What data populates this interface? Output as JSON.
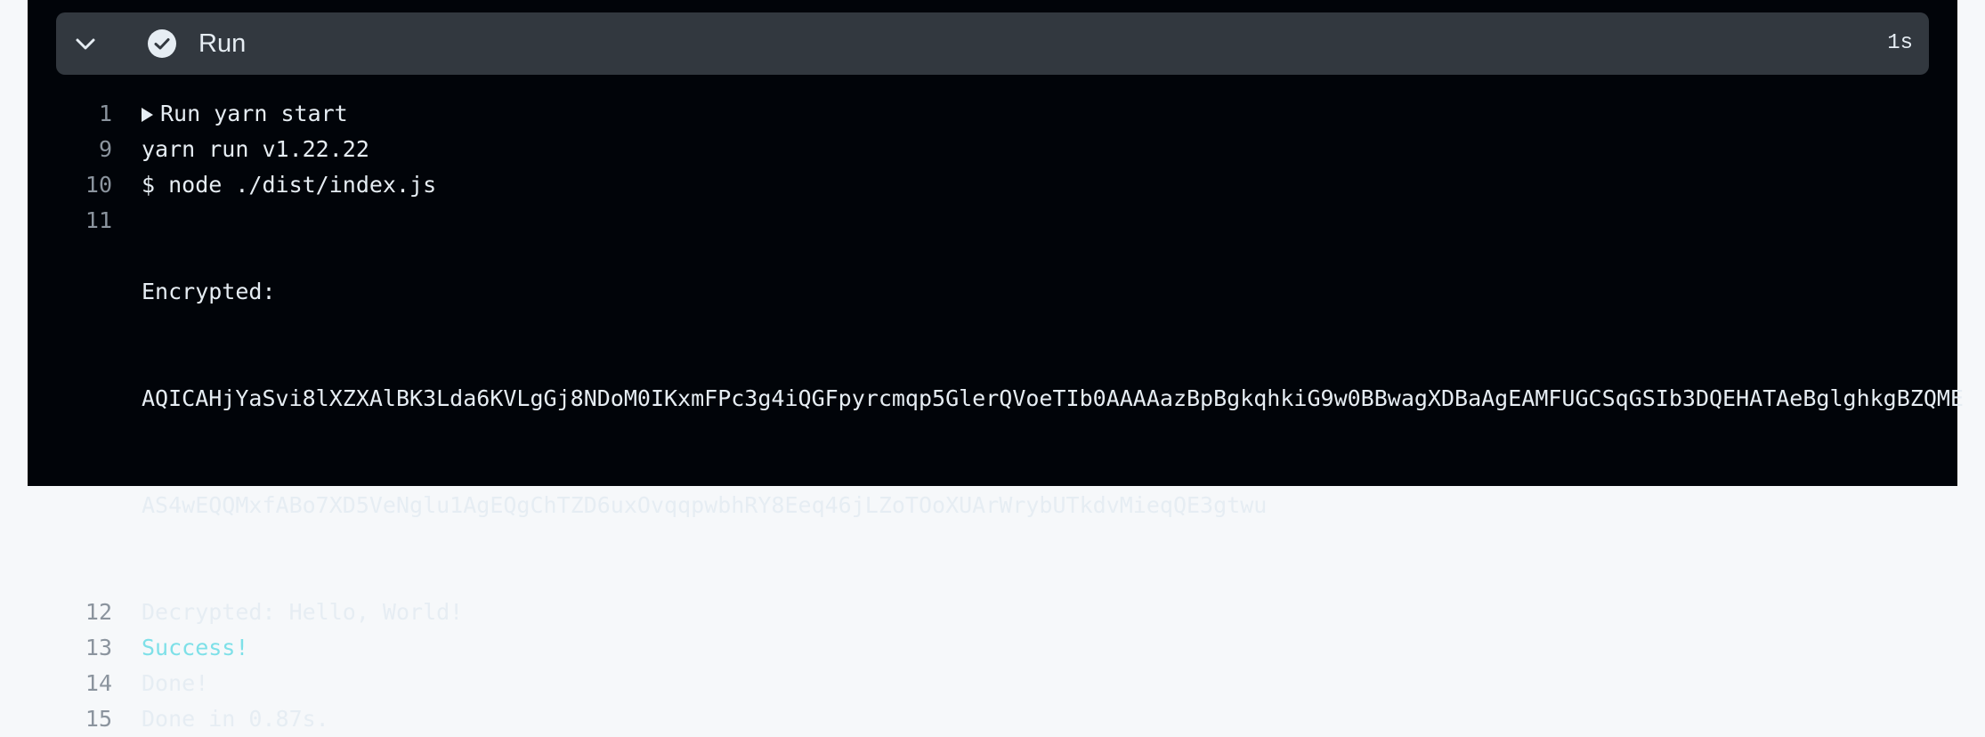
{
  "step": {
    "title": "Run",
    "duration": "1s",
    "status_icon": "check-circle-icon",
    "toggle_icon": "chevron-down-icon"
  },
  "colors": {
    "background": "#010409",
    "header": "#32383f",
    "text": "#e6edf3",
    "line_number": "#8b949e",
    "success": "#7ee0e8"
  },
  "log": {
    "group": {
      "num": "1",
      "text": "Run yarn start"
    },
    "yarn_version": {
      "num": "9",
      "text": "yarn run v1.22.22"
    },
    "node_cmd": {
      "num": "10",
      "text": "$ node ./dist/index.js"
    },
    "encrypted": {
      "num": "11",
      "text": "Encrypted:",
      "value_line1": "AQICAHjYaSvi8lXZXAlBK3Lda6KVLgGj8NDoM0IKxmFPc3g4iQGFpyrcmqp5GlerQVoeTIb0AAAAazBpBgkqhkiG9w0BBwagXDBaAgEAMFUGCSqGSIb3DQEHATAeBglghkgBZQME",
      "value_line2": "AS4wEQQMxfABo7XD5VeNglu1AgEQgChTZD6uxOvqqpwbhRY8Eeq46jLZoTOoXUArWrybUTkdvMieqQE3gtwu"
    },
    "decrypted": {
      "num": "12",
      "text": "Decrypted: Hello, World!"
    },
    "success": {
      "num": "13",
      "text": "Success!"
    },
    "done": {
      "num": "14",
      "text": "Done!"
    },
    "done_time": {
      "num": "15",
      "text": "Done in 0.87s."
    }
  }
}
